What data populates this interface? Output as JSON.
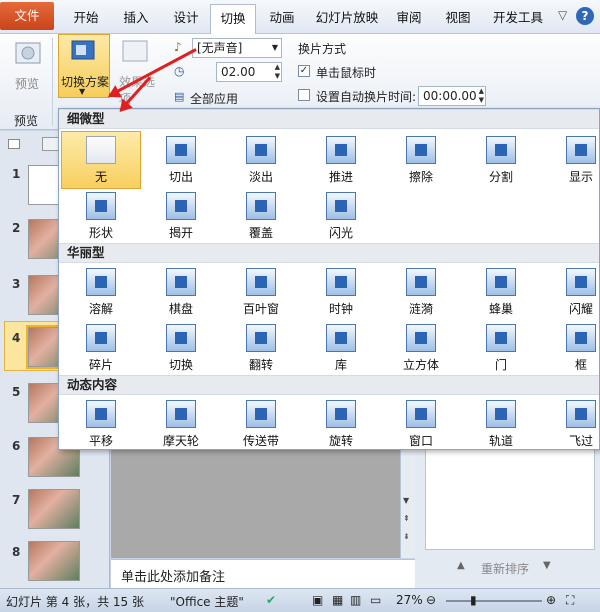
{
  "tabs": [
    {
      "key": "file",
      "label": "文件"
    },
    {
      "key": "home",
      "label": "开始"
    },
    {
      "key": "insert",
      "label": "插入"
    },
    {
      "key": "design",
      "label": "设计"
    },
    {
      "key": "transitions",
      "label": "切换"
    },
    {
      "key": "animations",
      "label": "动画"
    },
    {
      "key": "slideshow",
      "label": "幻灯片放映"
    },
    {
      "key": "review",
      "label": "审阅"
    },
    {
      "key": "view",
      "label": "视图"
    },
    {
      "key": "developer",
      "label": "开发工具"
    }
  ],
  "window_controls": {
    "minimize": "▽",
    "help": "?"
  },
  "ribbon": {
    "preview_label": "预览",
    "preview_group_label": "预览",
    "transition_scheme_label": "切换方案",
    "effect_options_label": "效果选项",
    "sound_value": "[无声音]",
    "duration_value": "02.00",
    "apply_all_label": "全部应用",
    "switch_mode_label": "换片方式",
    "on_click_label": "单击鼠标时",
    "on_click_checked": true,
    "auto_after_label": "设置自动换片时间:",
    "auto_after_checked": false,
    "auto_after_value": "00:00.00"
  },
  "gallery": {
    "categories": [
      {
        "title": "细微型",
        "items": [
          {
            "label": "无",
            "selected": true,
            "plain": true
          },
          {
            "label": "切出"
          },
          {
            "label": "淡出"
          },
          {
            "label": "推进"
          },
          {
            "label": "擦除"
          },
          {
            "label": "分割"
          },
          {
            "label": "显示"
          },
          {
            "label": "形状"
          },
          {
            "label": "揭开"
          },
          {
            "label": "覆盖"
          },
          {
            "label": "闪光"
          }
        ]
      },
      {
        "title": "华丽型",
        "items": [
          {
            "label": "溶解"
          },
          {
            "label": "棋盘"
          },
          {
            "label": "百叶窗"
          },
          {
            "label": "时钟"
          },
          {
            "label": "涟漪"
          },
          {
            "label": "蜂巢"
          },
          {
            "label": "闪耀"
          },
          {
            "label": "碎片"
          },
          {
            "label": "切换"
          },
          {
            "label": "翻转"
          },
          {
            "label": "库"
          },
          {
            "label": "立方体"
          },
          {
            "label": "门"
          },
          {
            "label": "框"
          }
        ]
      },
      {
        "title": "动态内容",
        "items": [
          {
            "label": "平移"
          },
          {
            "label": "摩天轮"
          },
          {
            "label": "传送带"
          },
          {
            "label": "旋转"
          },
          {
            "label": "窗口"
          },
          {
            "label": "轨道"
          },
          {
            "label": "飞过"
          }
        ]
      }
    ]
  },
  "slides": [
    {
      "num": "1"
    },
    {
      "num": "2"
    },
    {
      "num": "3"
    },
    {
      "num": "4",
      "selected": true
    },
    {
      "num": "5"
    },
    {
      "num": "6"
    },
    {
      "num": "7"
    },
    {
      "num": "8"
    }
  ],
  "notes_placeholder": "单击此处添加备注",
  "reorder_label": "重新排序",
  "status": {
    "slide_info": "幻灯片 第 4 张，共 15 张",
    "theme": "\"Office 主题\"",
    "zoom": "27%"
  }
}
